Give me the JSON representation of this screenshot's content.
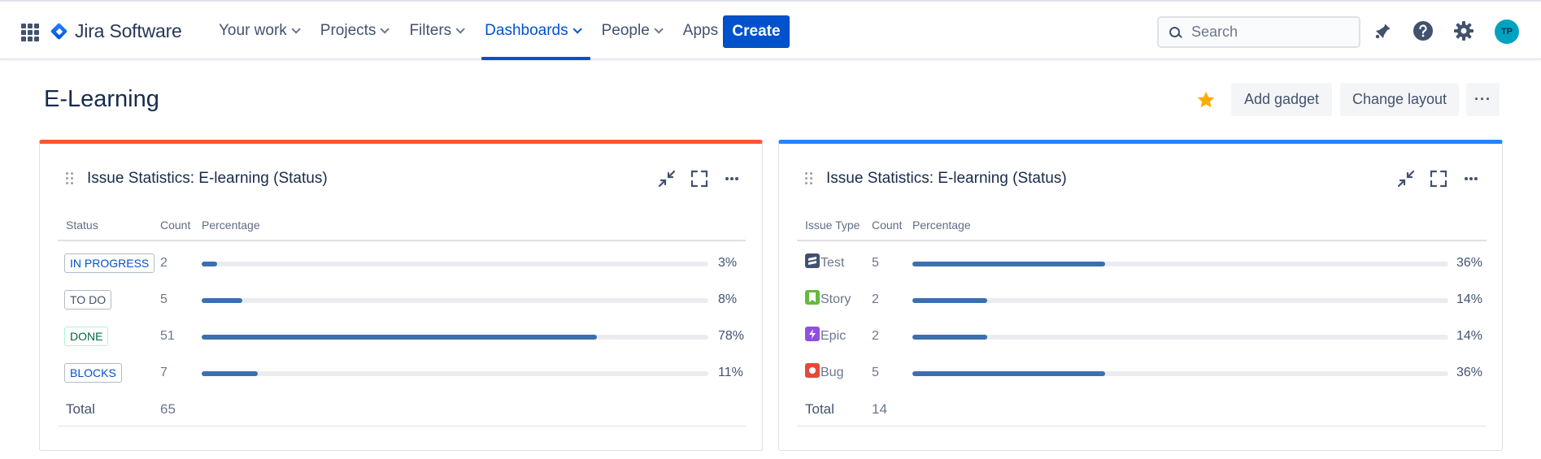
{
  "nav": {
    "product": "Jira Software",
    "items": [
      {
        "label": "Your work"
      },
      {
        "label": "Projects"
      },
      {
        "label": "Filters"
      },
      {
        "label": "Dashboards",
        "active": true
      },
      {
        "label": "People"
      },
      {
        "label": "Apps"
      }
    ],
    "create_label": "Create",
    "search_placeholder": "Search",
    "avatar_initials": "TP",
    "icons": [
      "app-switcher-icon",
      "notifications-icon",
      "help-icon",
      "settings-icon"
    ]
  },
  "page": {
    "title": "E-Learning",
    "add_gadget_label": "Add gadget",
    "change_layout_label": "Change layout",
    "more_label": "···"
  },
  "colors": {
    "accent": "#0052cc",
    "bar": "#3c6fb0",
    "gadget1_top": "#ff5630",
    "gadget2_top": "#2684ff",
    "star": "#ffab00"
  },
  "gadget1": {
    "title": "Issue Statistics: E-learning (Status)",
    "col_status": "Status",
    "col_count": "Count",
    "col_pct": "Percentage",
    "rows": [
      {
        "label": "IN PROGRESS",
        "count": "2",
        "pct": "3%",
        "fraction": 0.03,
        "color": "#0052cc"
      },
      {
        "label": "TO DO",
        "count": "5",
        "pct": "8%",
        "fraction": 0.08,
        "color": "#42526e"
      },
      {
        "label": "DONE",
        "count": "51",
        "pct": "78%",
        "fraction": 0.78,
        "color": "#006644"
      },
      {
        "label": "BLOCKS",
        "count": "7",
        "pct": "11%",
        "fraction": 0.11,
        "color": "#0052cc"
      }
    ],
    "total_label": "Total",
    "total_value": "65"
  },
  "gadget2": {
    "title": "Issue Statistics: E-learning (Status)",
    "col_type": "Issue Type",
    "col_count": "Count",
    "col_pct": "Percentage",
    "rows": [
      {
        "label": "Test",
        "count": "5",
        "pct": "36%",
        "fraction": 0.36,
        "icon": "test-icon"
      },
      {
        "label": "Story",
        "count": "2",
        "pct": "14%",
        "fraction": 0.14,
        "icon": "story-icon"
      },
      {
        "label": "Epic",
        "count": "2",
        "pct": "14%",
        "fraction": 0.14,
        "icon": "epic-icon"
      },
      {
        "label": "Bug",
        "count": "5",
        "pct": "36%",
        "fraction": 0.36,
        "icon": "bug-icon"
      }
    ],
    "total_label": "Total",
    "total_value": "14"
  }
}
